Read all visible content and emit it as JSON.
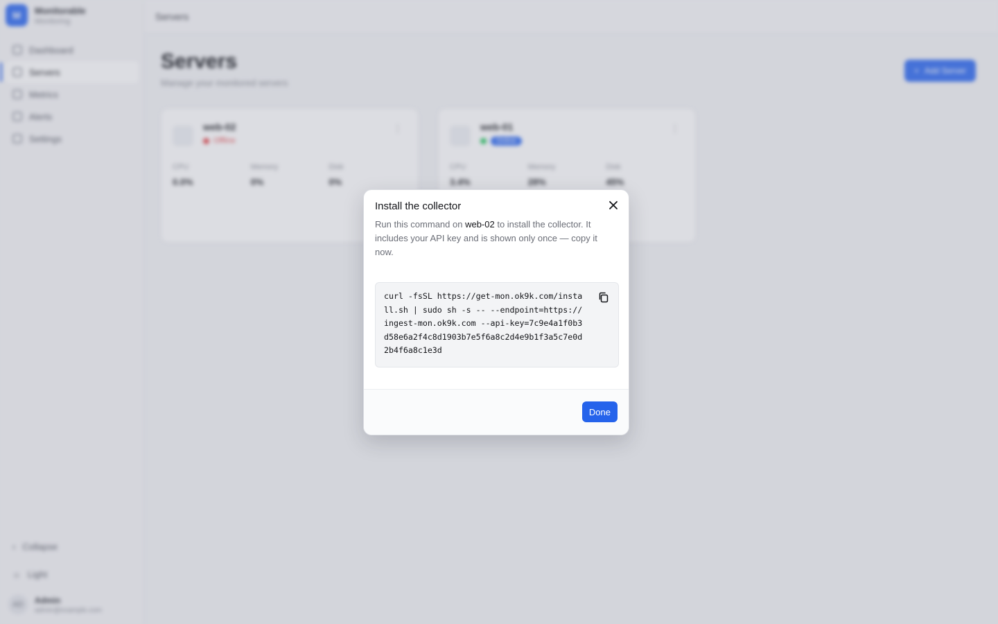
{
  "app": {
    "brand_name": "Monitorable",
    "brand_sub": "Monitoring",
    "brand_initial": "M",
    "nav": [
      {
        "label": "Dashboard"
      },
      {
        "label": "Servers"
      },
      {
        "label": "Metrics"
      },
      {
        "label": "Alerts"
      },
      {
        "label": "Settings"
      }
    ],
    "collapse_label": "Collapse",
    "theme_label": "Light",
    "user": {
      "initials": "AD",
      "name": "Admin",
      "email": "admin@example.com"
    }
  },
  "topbar": {
    "breadcrumb": "Servers"
  },
  "page": {
    "title": "Servers",
    "subtitle": "Manage your monitored servers",
    "add_button": "Add Server"
  },
  "servers": [
    {
      "name": "web-02",
      "status": "Offline",
      "status_color": "#e5484d",
      "metrics": [
        {
          "label": "CPU",
          "value": "0.0%"
        },
        {
          "label": "Memory",
          "value": "0%"
        },
        {
          "label": "Disk",
          "value": "0%"
        }
      ]
    },
    {
      "name": "web-01",
      "status": "Online",
      "status_color": "#2f6bf2",
      "metrics": [
        {
          "label": "CPU",
          "value": "3.4%"
        },
        {
          "label": "Memory",
          "value": "28%"
        },
        {
          "label": "Disk",
          "value": "45%"
        }
      ]
    }
  ],
  "dialog": {
    "title": "Install the collector",
    "desc_before": "Run this command on ",
    "desc_server": "web-02",
    "desc_after": " to install the collector. It includes your API key and is shown only once — copy it now.",
    "command": "curl -fsSL https://get-mon.ok9k.com/install.sh | sudo sh -s -- --endpoint=https://ingest-mon.ok9k.com --api-key=7c9e4a1f0b3d58e6a2f4c8d1903b7e5f6a8c2d4e9b1f3a5c7e0d2b4f6a8c1e3d",
    "done_label": "Done"
  },
  "colors": {
    "accent": "#2563eb",
    "offline": "#e5484d",
    "online": "#22c55e"
  }
}
